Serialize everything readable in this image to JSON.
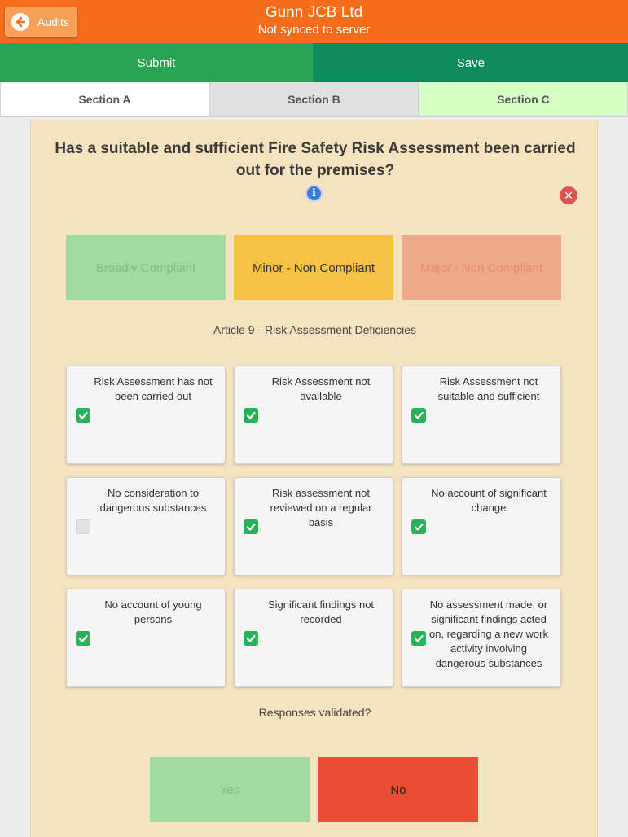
{
  "header": {
    "back_label": "Audits",
    "title": "Gunn JCB Ltd",
    "subtitle": "Not synced to server"
  },
  "actions": {
    "submit_label": "Submit",
    "save_label": "Save"
  },
  "tabs": [
    {
      "label": "Section A"
    },
    {
      "label": "Section B"
    },
    {
      "label": "Section C"
    }
  ],
  "question": {
    "text": "Has a suitable and sufficient Fire Safety Risk Assessment been carried out for the premises?",
    "info_glyph": "i",
    "close_glyph": "✕"
  },
  "ratings": [
    {
      "label": "Broadly Compliant",
      "selected": false
    },
    {
      "label": "Minor - Non Compliant",
      "selected": true
    },
    {
      "label": "Major - Non Compliant",
      "selected": false
    }
  ],
  "deficiencies_title": "Article 9 - Risk Assessment Deficiencies",
  "deficiencies": [
    {
      "label": "Risk Assessment has not been carried out",
      "checked": true
    },
    {
      "label": "Risk Assessment not available",
      "checked": true
    },
    {
      "label": "Risk Assessment not suitable and sufficient",
      "checked": true
    },
    {
      "label": "No consideration to dangerous substances",
      "checked": false
    },
    {
      "label": "Risk assessment not reviewed on a regular basis",
      "checked": true
    },
    {
      "label": "No account of significant change",
      "checked": true
    },
    {
      "label": "No account of young persons",
      "checked": true
    },
    {
      "label": "Significant findings not recorded",
      "checked": true
    },
    {
      "label": "No assessment made, or significant findings acted on, regarding a new work activity involving dangerous substances",
      "checked": true
    }
  ],
  "validation": {
    "prompt": "Responses validated?",
    "yes_label": "Yes",
    "no_label": "No",
    "selected": "No"
  },
  "colors": {
    "header": "#f56c1a",
    "submit": "#29a354",
    "save": "#0f8c5f",
    "panel": "#f5e2bf",
    "check": "#27b35a",
    "minor": "#f6c244",
    "no": "#e84e33"
  }
}
